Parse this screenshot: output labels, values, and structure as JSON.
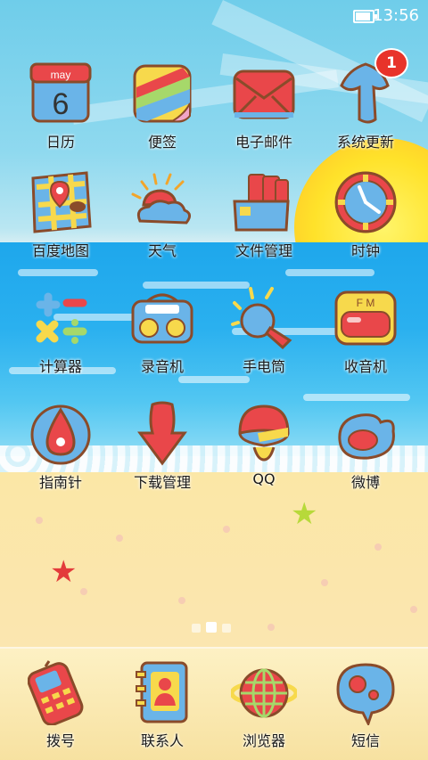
{
  "status": {
    "time": "13:56",
    "battery_percent": 90
  },
  "badge": {
    "count": "1"
  },
  "apps": [
    {
      "label": "日历",
      "icon": "calendar-icon",
      "date": "6",
      "month": "may"
    },
    {
      "label": "便签",
      "icon": "notes-icon"
    },
    {
      "label": "电子邮件",
      "icon": "email-icon"
    },
    {
      "label": "系统更新",
      "icon": "system-update-icon"
    },
    {
      "label": "百度地图",
      "icon": "map-icon"
    },
    {
      "label": "天气",
      "icon": "weather-icon"
    },
    {
      "label": "文件管理",
      "icon": "file-manager-icon"
    },
    {
      "label": "时钟",
      "icon": "clock-icon"
    },
    {
      "label": "计算器",
      "icon": "calculator-icon"
    },
    {
      "label": "录音机",
      "icon": "recorder-icon"
    },
    {
      "label": "手电筒",
      "icon": "flashlight-icon"
    },
    {
      "label": "收音机",
      "icon": "radio-icon",
      "fm": "F M"
    },
    {
      "label": "指南针",
      "icon": "compass-icon"
    },
    {
      "label": "下载管理",
      "icon": "download-icon"
    },
    {
      "label": "QQ",
      "icon": "qq-icon"
    },
    {
      "label": "微博",
      "icon": "weibo-icon"
    }
  ],
  "dock": [
    {
      "label": "拨号",
      "icon": "phone-icon"
    },
    {
      "label": "联系人",
      "icon": "contacts-icon"
    },
    {
      "label": "浏览器",
      "icon": "browser-icon"
    },
    {
      "label": "短信",
      "icon": "sms-icon"
    }
  ],
  "pager": {
    "pages": 3,
    "current": 2
  },
  "colors": {
    "red": "#e9474a",
    "blue": "#6ab4e8",
    "yellow": "#f7d94c",
    "outline": "#8a4b2a"
  }
}
